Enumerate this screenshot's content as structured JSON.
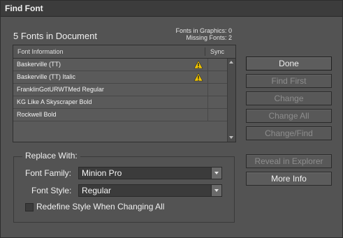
{
  "window": {
    "title": "Find Font"
  },
  "summary": {
    "fonts_in_document": "5 Fonts in Document",
    "fonts_in_graphics": "Fonts in Graphics: 0",
    "missing_fonts": "Missing Fonts: 2"
  },
  "font_list": {
    "headers": {
      "font_information": "Font Information",
      "sync": "Sync"
    },
    "rows": [
      {
        "name": "Baskerville (TT)",
        "warning": true
      },
      {
        "name": "Baskerville (TT) Italic",
        "warning": true
      },
      {
        "name": "FranklinGotURWTMed Regular",
        "warning": false
      },
      {
        "name": "KG Like A Skyscraper Bold",
        "warning": false
      },
      {
        "name": "Rockwell Bold",
        "warning": false
      }
    ]
  },
  "buttons": {
    "done": "Done",
    "find_first": "Find First",
    "change": "Change",
    "change_all": "Change All",
    "change_find": "Change/Find",
    "reveal_in_explorer": "Reveal in Explorer",
    "more_info": "More Info"
  },
  "replace_with": {
    "legend": "Replace With:",
    "font_family_label": "Font Family:",
    "font_family_value": "Minion Pro",
    "font_style_label": "Font Style:",
    "font_style_value": "Regular",
    "redefine_label": "Redefine Style When Changing All",
    "redefine_checked": false
  },
  "icons": {
    "warning": "warning-triangle-icon"
  },
  "colors": {
    "dialog_bg": "#535353",
    "titlebar_bg": "#3c3c3c",
    "warning_yellow": "#f0c400"
  }
}
